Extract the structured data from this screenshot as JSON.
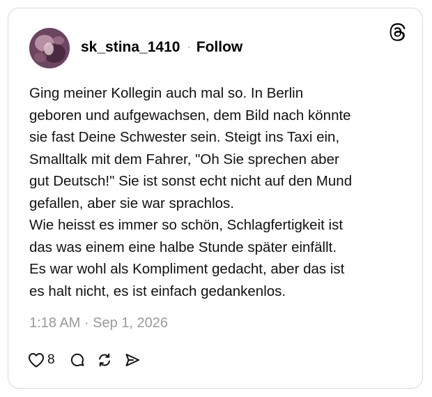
{
  "post": {
    "username": "sk_stina_1410",
    "separator": "·",
    "follow_label": "Follow",
    "body": "Ging meiner Kollegin auch mal so. In Berlin\ngeboren und aufgewachsen, dem Bild nach könnte\nsie fast Deine Schwester sein. Steigt ins Taxi ein,\nSmalltalk mit dem Fahrer, \"Oh Sie sprechen aber\ngut Deutsch!\" Sie ist sonst echt nicht auf den Mund\ngefallen, aber sie war sprachlos.\nWie heisst es immer so schön, Schlagfertigkeit ist\ndas was einem eine halbe Stunde später einfällt.\nEs war wohl als Kompliment gedacht, aber das ist\nes halt nicht, es ist einfach gedankenlos.",
    "timestamp": "1:18 AM · Sep 1, 2026",
    "like_count": "8"
  },
  "icons": {
    "logo": "threads-logo-icon",
    "like": "heart-icon",
    "reply": "comment-icon",
    "repost": "repost-icon",
    "share": "send-icon"
  },
  "colors": {
    "text": "#111111",
    "muted": "#9a9a9a",
    "border": "#d9d9d9",
    "background": "#ffffff"
  }
}
